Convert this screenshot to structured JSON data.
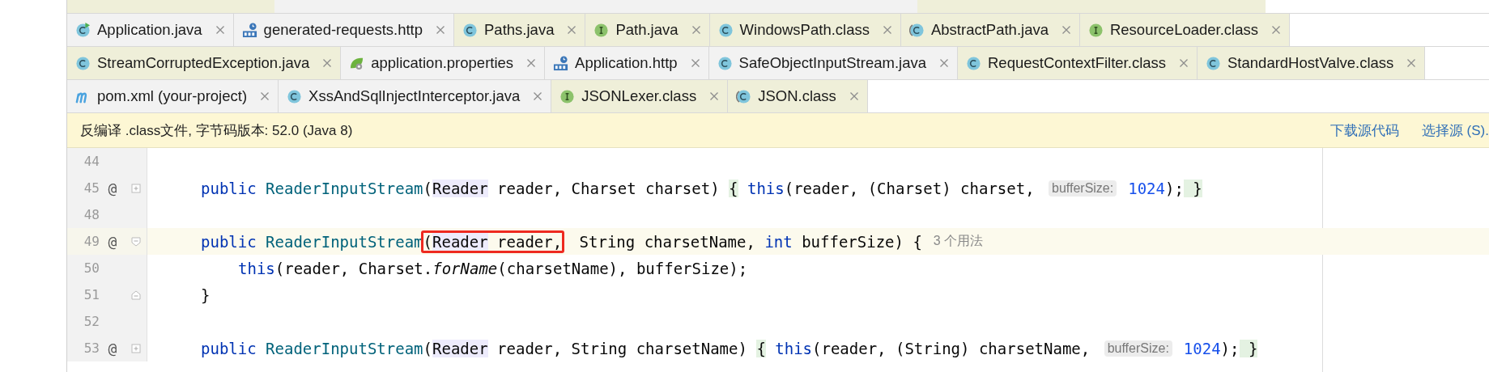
{
  "tab_rows": [
    {
      "tabs": [
        {
          "label": "Application.java",
          "kind": "app",
          "library": false
        },
        {
          "label": "generated-requests.http",
          "kind": "http",
          "library": false
        },
        {
          "label": "Paths.java",
          "kind": "class",
          "library": true
        },
        {
          "label": "Path.java",
          "kind": "interface",
          "library": true
        },
        {
          "label": "WindowsPath.class",
          "kind": "class",
          "library": true
        },
        {
          "label": "AbstractPath.java",
          "kind": "abstract",
          "library": true
        },
        {
          "label": "ResourceLoader.class",
          "kind": "interface",
          "library": true
        }
      ]
    },
    {
      "tabs": [
        {
          "label": "StreamCorruptedException.java",
          "kind": "class",
          "library": true
        },
        {
          "label": "application.properties",
          "kind": "properties",
          "library": false
        },
        {
          "label": "Application.http",
          "kind": "http",
          "library": false
        },
        {
          "label": "SafeObjectInputStream.java",
          "kind": "class",
          "library": false
        },
        {
          "label": "RequestContextFilter.class",
          "kind": "class",
          "library": true
        },
        {
          "label": "StandardHostValve.class",
          "kind": "class",
          "library": true
        }
      ]
    },
    {
      "tabs": [
        {
          "label": "pom.xml (your-project)",
          "kind": "maven",
          "library": false
        },
        {
          "label": "XssAndSqlInjectInterceptor.java",
          "kind": "class",
          "library": false
        },
        {
          "label": "JSONLexer.class",
          "kind": "interface",
          "library": true
        },
        {
          "label": "JSON.class",
          "kind": "abstract",
          "library": true
        }
      ]
    }
  ],
  "banner": {
    "text": "反编译 .class文件, 字节码版本: 52.0 (Java 8)",
    "links": [
      "下载源代码",
      "选择源 (S)."
    ]
  },
  "lines": [
    {
      "number": "44",
      "current": false
    },
    {
      "number": "45",
      "marker": "@",
      "fold": {
        "kind": "expand"
      },
      "current": false,
      "kind": "member",
      "segments": [
        {
          "kind": "code",
          "tokens": [
            {
              "t": "public ",
              "kind": "kw"
            },
            {
              "t": "ReaderInputStream",
              "kind": "fn"
            },
            {
              "t": "(",
              "kind": "plain"
            },
            {
              "t": "Reader",
              "kind": "ref"
            },
            {
              "t": " reader, Charset charset) ",
              "kind": "plain"
            },
            {
              "t": "{",
              "kind": "brace"
            },
            {
              "t": " this",
              "kind": "kw"
            },
            {
              "t": "(reader, (Charset) charset, ",
              "kind": "plain"
            }
          ]
        },
        {
          "kind": "inlay",
          "text": "bufferSize:"
        },
        {
          "kind": "code",
          "tokens": [
            {
              "t": "1024",
              "kind": "num"
            },
            {
              "t": ");",
              "kind": "plain"
            },
            {
              "t": " }",
              "kind": "brace"
            }
          ]
        }
      ]
    },
    {
      "number": "48",
      "current": false
    },
    {
      "number": "49",
      "marker": "@",
      "fold": {
        "kind": "collapse"
      },
      "current": true,
      "kind": "member",
      "segments": [
        {
          "kind": "code",
          "tokens": [
            {
              "t": "public ",
              "kind": "kw"
            },
            {
              "t": "ReaderInputStream",
              "kind": "fn"
            }
          ]
        },
        {
          "kind": "boxed",
          "tokens": [
            {
              "t": "(",
              "kind": "plain"
            },
            {
              "t": "Reader",
              "kind": "ref"
            },
            {
              "t": " reader,",
              "kind": "plain"
            }
          ]
        },
        {
          "kind": "code",
          "tokens": [
            {
              "t": " String charsetName, ",
              "kind": "plain"
            },
            {
              "t": "int",
              "kind": "kw"
            },
            {
              "t": " bufferSize) {",
              "kind": "plain"
            }
          ]
        },
        {
          "kind": "usages",
          "text": "3 个用法"
        }
      ]
    },
    {
      "number": "50",
      "current": false,
      "kind": "inner",
      "segments": [
        {
          "kind": "code",
          "tokens": [
            {
              "t": "this",
              "kind": "kw"
            },
            {
              "t": "(reader, Charset.",
              "kind": "plain"
            },
            {
              "t": "forName",
              "kind": "italic"
            },
            {
              "t": "(charsetName), bufferSize);",
              "kind": "plain"
            }
          ]
        }
      ]
    },
    {
      "number": "51",
      "fold": {
        "kind": "end"
      },
      "current": false,
      "kind": "member",
      "segments": [
        {
          "kind": "code",
          "tokens": [
            {
              "t": "}",
              "kind": "plain"
            }
          ]
        }
      ]
    },
    {
      "number": "52",
      "current": false
    },
    {
      "number": "53",
      "marker": "@",
      "fold": {
        "kind": "expand"
      },
      "current": false,
      "kind": "member",
      "segments": [
        {
          "kind": "code",
          "tokens": [
            {
              "t": "public ",
              "kind": "kw"
            },
            {
              "t": "ReaderInputStream",
              "kind": "fn"
            },
            {
              "t": "(",
              "kind": "plain"
            },
            {
              "t": "Reader",
              "kind": "ref"
            },
            {
              "t": " reader, String charsetName) ",
              "kind": "plain"
            },
            {
              "t": "{",
              "kind": "brace"
            },
            {
              "t": " this",
              "kind": "kw"
            },
            {
              "t": "(reader, (String) charsetName, ",
              "kind": "plain"
            }
          ]
        },
        {
          "kind": "inlay",
          "text": "bufferSize:"
        },
        {
          "kind": "code",
          "tokens": [
            {
              "t": "1024",
              "kind": "num"
            },
            {
              "t": ");",
              "kind": "plain"
            },
            {
              "t": " }",
              "kind": "brace"
            }
          ]
        }
      ]
    }
  ]
}
